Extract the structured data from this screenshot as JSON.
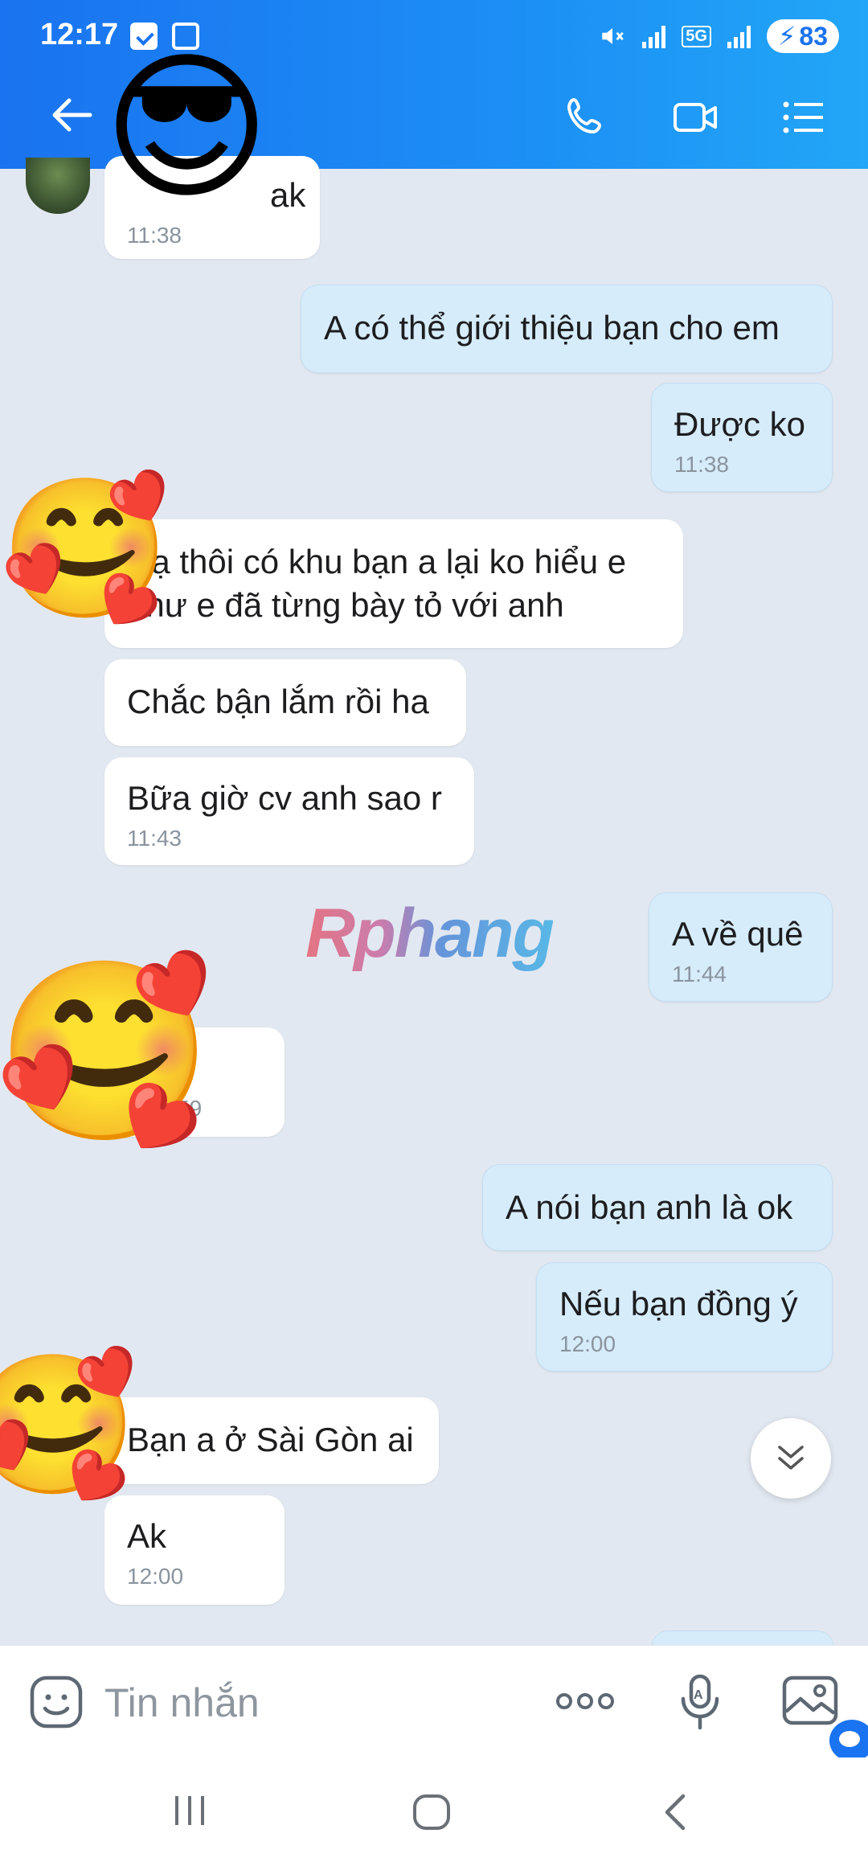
{
  "status_bar": {
    "time": "12:17",
    "network": "5G",
    "battery": "83"
  },
  "header": {
    "contact_avatar_emoji": "😎"
  },
  "colors": {
    "header_start": "#1a73f0",
    "header_end": "#22a6f7",
    "outgoing_bubble": "#d6ecfb",
    "incoming_bubble": "#ffffff",
    "chat_background": "#e2e8f1"
  },
  "messages": [
    {
      "side": "in",
      "text": "ak",
      "time": "11:38"
    },
    {
      "side": "out",
      "text": "A có thể giới thiệu bạn cho em",
      "time": ""
    },
    {
      "side": "out",
      "text": "Được ko",
      "time": "11:38"
    },
    {
      "side": "in",
      "text": "Dạ thôi có khu bạn a lại ko hiểu e như e đã từng bày tỏ với anh",
      "time": ""
    },
    {
      "side": "in",
      "text": "Chắc bận lắm rồi ha",
      "time": ""
    },
    {
      "side": "in",
      "text": "Bữa giờ cv anh sao r",
      "time": "11:43"
    },
    {
      "side": "out",
      "text": "A về quê",
      "time": "11:44"
    },
    {
      "side": "in",
      "text": "",
      "time": "59"
    },
    {
      "side": "out",
      "text": "A nói bạn anh là ok",
      "time": ""
    },
    {
      "side": "out",
      "text": "Nếu bạn đồng ý",
      "time": "12:00"
    },
    {
      "side": "in",
      "text": "Bạn a ở Sài Gòn ai",
      "time": ""
    },
    {
      "side": "in",
      "text": "Ak",
      "time": "12:00"
    }
  ],
  "sticker_emojis": {
    "hearts_face": "🥰"
  },
  "watermark": "Rphang",
  "composer": {
    "placeholder": "Tin nhắn"
  },
  "icons": {
    "back": "back-arrow-icon",
    "call": "phone-icon",
    "video": "video-call-icon",
    "menu": "list-menu-icon",
    "emoji": "emoji-icon",
    "more": "more-dots-icon",
    "mic": "mic-icon",
    "image": "image-icon",
    "scroll_down": "double-chevron-down-icon"
  }
}
